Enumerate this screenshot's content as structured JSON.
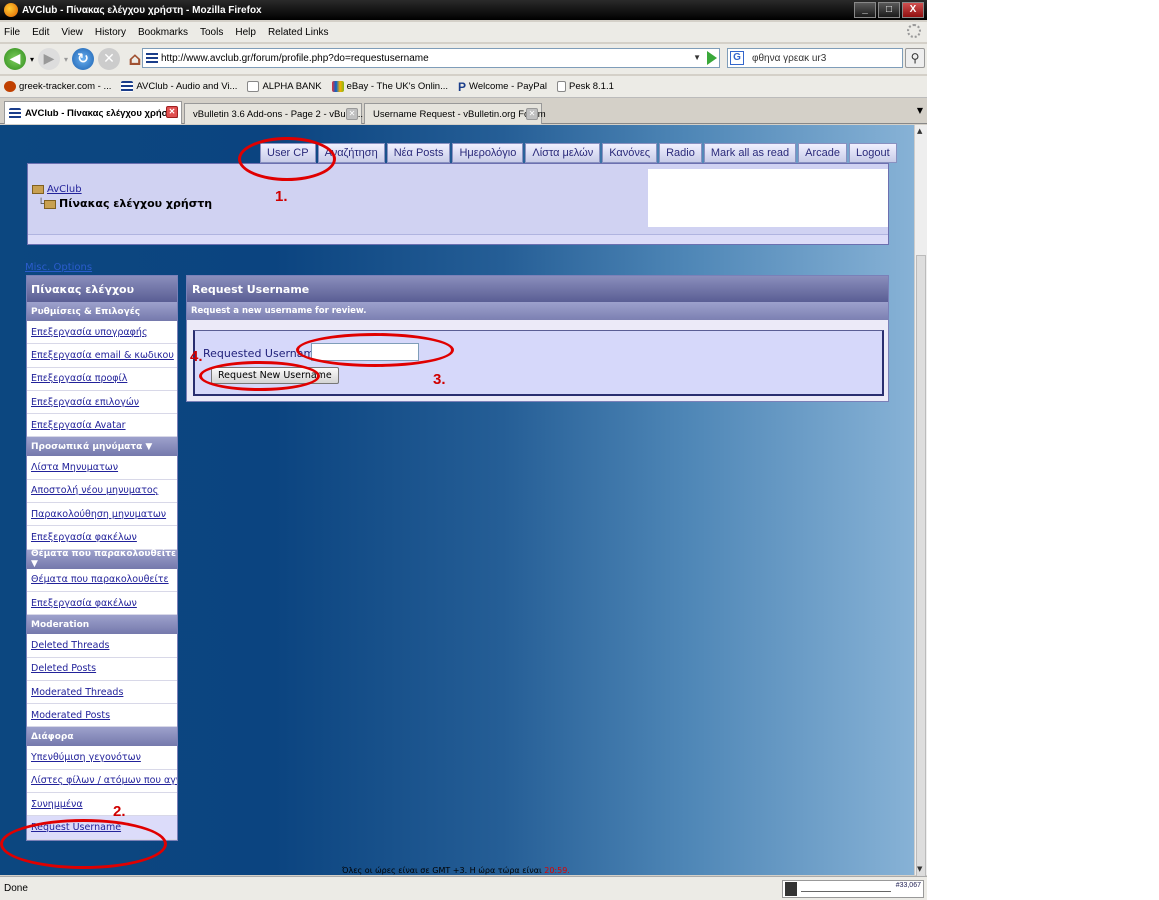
{
  "window": {
    "title": "AVClub - Πίνακας ελέγχου χρήστη - Mozilla Firefox",
    "controls": [
      "_",
      "□",
      "X"
    ]
  },
  "menu": [
    "File",
    "Edit",
    "View",
    "History",
    "Bookmarks",
    "Tools",
    "Help",
    "Related Links"
  ],
  "nav": {
    "url": "http://www.avclub.gr/forum/profile.php?do=requestusername",
    "search_value": "φθηνα γρεακ ur3",
    "search_engine_letter": "G"
  },
  "bookmarks": [
    {
      "label": "greek-tracker.com - ...",
      "color": "#c04000"
    },
    {
      "label": "AVClub - Audio and Vi...",
      "color": "#1a3d8a"
    },
    {
      "label": "ALPHA BANK",
      "color": "#888888"
    },
    {
      "label": "eBay - The UK's Onlin...",
      "color": "#e0a000"
    },
    {
      "label": "Welcome - PayPal",
      "color": "#1a3d8a"
    },
    {
      "label": "Pesk 8.1.1",
      "color": "#dddddd"
    }
  ],
  "tabs": [
    {
      "label": "AVClub - Πίνακας ελέγχου χρήστη",
      "active": true
    },
    {
      "label": "vBulletin 3.6 Add-ons - Page 2 - vBulle...",
      "active": false
    },
    {
      "label": "Username Request - vBulletin.org Forum",
      "active": false
    }
  ],
  "forum_nav": [
    "User CP",
    "Αναζήτηση",
    "Νέα Posts",
    "Ημερολόγιο",
    "Λίστα μελών",
    "Κανόνες",
    "Radio",
    "Mark all as read",
    "Arcade",
    "Logout"
  ],
  "breadcrumb": {
    "root": "AvClub",
    "current": "Πίνακας ελέγχου χρήστη"
  },
  "misc_link": "Misc. Options",
  "sidebar": {
    "title": "Πίνακας ελέγχου",
    "sections": [
      {
        "title": "Ρυθμίσεις & Επιλογές",
        "items": [
          "Επεξεργασία υπογραφής",
          "Επεξεργασία email & κωδικου",
          "Επεξεργασία προφίλ",
          "Επεξεργασία επιλογών",
          "Επεξεργασία Avatar"
        ]
      },
      {
        "title": "Προσωπικά μηνύματα ▼",
        "items": [
          "Λίστα Μηνυματων",
          "Αποστολή νέου μηνυματος",
          "Παρακολούθηση μηνυματων",
          "Επεξεργασία φακέλων"
        ]
      },
      {
        "title": "Θέματα που παρακολουθείτε ▼",
        "items": [
          "Θέματα που παρακολουθείτε",
          "Επεξεργασία φακέλων"
        ]
      },
      {
        "title": "Moderation",
        "items": [
          "Deleted Threads",
          "Deleted Posts",
          "Moderated Threads",
          "Moderated Posts"
        ]
      },
      {
        "title": "Διάφορα",
        "items": [
          "Υπενθύμιση γεγονότων",
          "Λίστες φίλων / ατόμων που αγνοώ",
          "Συνημμένα",
          "Request Username"
        ]
      }
    ],
    "selected": "Request Username"
  },
  "panel": {
    "title": "Request Username",
    "subtitle": "Request a new username for review.",
    "field_label": "Requested Username:",
    "field_value": "",
    "button": "Request New Username"
  },
  "footer": {
    "text": "Όλες οι ώρες είναι σε GMT +3. Η ώρα τώρα είναι",
    "time": "20:59."
  },
  "annotations": [
    "1.",
    "2.",
    "3.",
    "4."
  ],
  "annotation_color": "#e00000",
  "status": {
    "text": "Done",
    "meter_value": "#33,067"
  }
}
